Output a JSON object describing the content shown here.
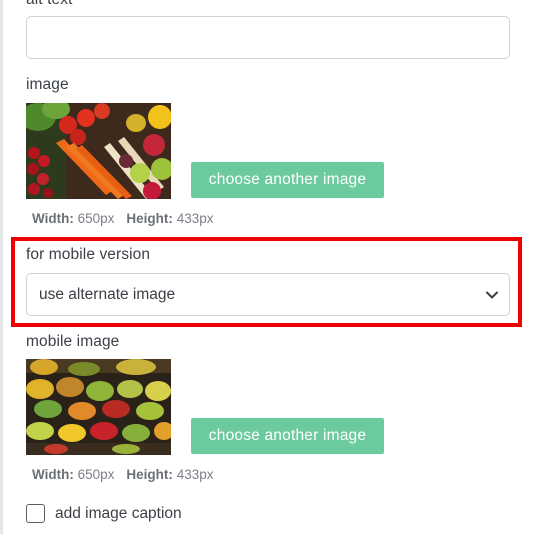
{
  "form": {
    "alt_text": {
      "label": "alt text",
      "value": "",
      "placeholder": ""
    },
    "image": {
      "label": "image",
      "button_label": "choose another image",
      "width_label": "Width:",
      "width_value": "650px",
      "height_label": "Height:",
      "height_value": "433px"
    },
    "mobile_version": {
      "label": "for mobile version",
      "selected": "use alternate image"
    },
    "mobile_image": {
      "label": "mobile image",
      "button_label": "choose another image",
      "width_label": "Width:",
      "width_value": "650px",
      "height_label": "Height:",
      "height_value": "433px"
    },
    "caption": {
      "label": "add image caption",
      "checked": false
    }
  },
  "colors": {
    "button_bg": "#6ccb9c",
    "highlight": "#ee0000",
    "border": "#ced3d9"
  },
  "icons": {
    "select_arrow": "chevron-down-icon"
  }
}
